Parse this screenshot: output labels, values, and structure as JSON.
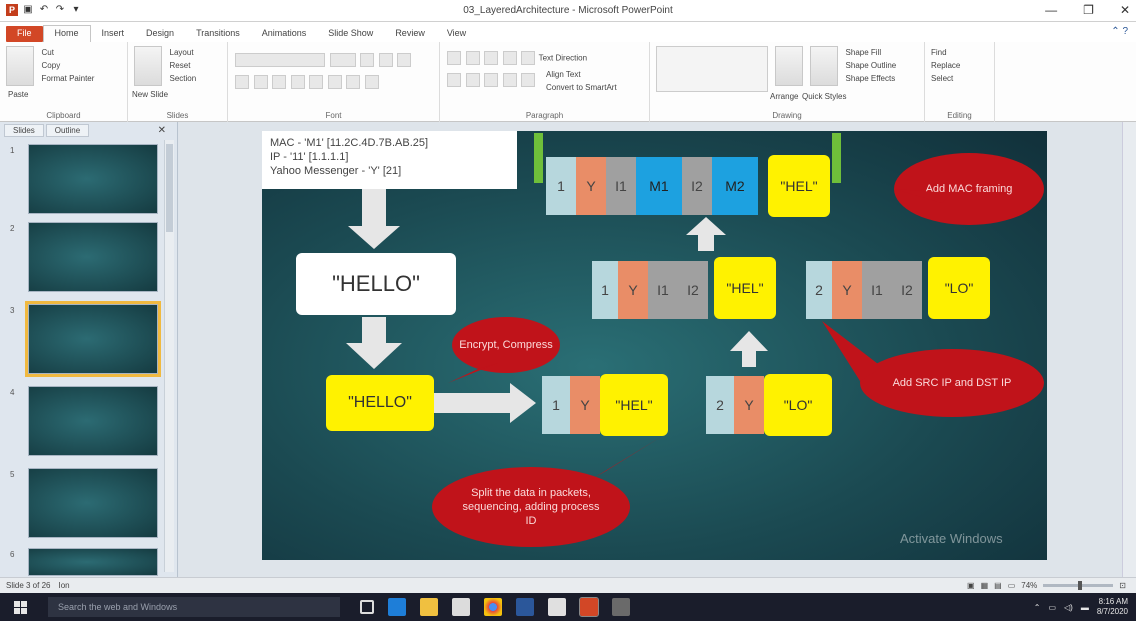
{
  "window": {
    "title": "03_LayeredArchitecture - Microsoft PowerPoint",
    "qat_icons": [
      "powerpoint-icon",
      "save-icon",
      "undo-icon",
      "redo-icon",
      "customize-icon"
    ],
    "controls": [
      "minimize-icon",
      "restore-icon",
      "close-icon"
    ]
  },
  "tabs": [
    "File",
    "Home",
    "Insert",
    "Design",
    "Transitions",
    "Animations",
    "Slide Show",
    "Review",
    "View"
  ],
  "active_tab": "Home",
  "ribbon": {
    "clipboard": {
      "label": "Clipboard",
      "paste": "Paste",
      "cut": "Cut",
      "copy": "Copy",
      "format_painter": "Format Painter"
    },
    "slides": {
      "label": "Slides",
      "new_slide": "New Slide",
      "layout": "Layout",
      "reset": "Reset",
      "section": "Section"
    },
    "font": {
      "label": "Font"
    },
    "paragraph": {
      "label": "Paragraph",
      "text_direction": "Text Direction",
      "align_text": "Align Text",
      "convert": "Convert to SmartArt"
    },
    "drawing": {
      "label": "Drawing",
      "arrange": "Arrange",
      "quick_styles": "Quick Styles",
      "shape_fill": "Shape Fill",
      "shape_outline": "Shape Outline",
      "shape_effects": "Shape Effects"
    },
    "editing": {
      "label": "Editing",
      "find": "Find",
      "replace": "Replace",
      "select": "Select"
    }
  },
  "side_panel": {
    "tabs": [
      "Slides",
      "Outline"
    ],
    "slides": [
      "1",
      "2",
      "3",
      "4",
      "5",
      "6"
    ],
    "selected": "3"
  },
  "slide": {
    "info_lines": [
      "MAC - 'M1'  [11.2C.4D.7B.AB.25]",
      "IP -        '11'    [1.1.1.1]",
      "Yahoo Messenger - 'Y'  [21]"
    ],
    "hello_white": "\"HELLO\"",
    "hello_yellow": "\"HELLO\"",
    "bubble_encrypt": "Encrypt, Compress",
    "bubble_mac": "Add MAC framing",
    "bubble_ip": "Add SRC IP and DST IP",
    "bubble_split": "Split the data in packets, sequencing, adding process ID",
    "packet_top": [
      "1",
      "Y",
      "I1",
      "M1",
      "I2",
      "M2",
      "\"HEL\""
    ],
    "packet_mid_left": [
      "1",
      "Y",
      "I1",
      "I2",
      "\"HEL\""
    ],
    "packet_mid_right": [
      "2",
      "Y",
      "I1",
      "I2",
      "\"LO\""
    ],
    "packet_bot_left": [
      "1",
      "Y",
      "\"HEL\""
    ],
    "packet_bot_right": [
      "2",
      "Y",
      "\"LO\""
    ],
    "watermark": "Activate Windows"
  },
  "status": {
    "slide_info": "Slide 3 of 26",
    "theme": "Ion",
    "zoom": "74%"
  },
  "taskbar": {
    "search_placeholder": "Search the web and Windows",
    "apps": [
      "task-view-icon",
      "edge-icon",
      "file-explorer-icon",
      "store-icon",
      "chrome-icon",
      "word-icon",
      "photos-icon",
      "powerpoint-app-icon",
      "fiddler-icon"
    ],
    "time": "8:16 AM",
    "date": "8/7/2020"
  },
  "colors": {
    "slide_bg": "#1b4a52",
    "bubble_red": "#c0131a",
    "packet_yellow": "#fff200",
    "packet_orange": "#e98d67",
    "packet_gray": "#a0a0a0",
    "packet_blue": "#b7d7dd",
    "packet_cyan": "#1da1e0",
    "frame_green": "#6fbf3a",
    "file_tab": "#d24726"
  }
}
